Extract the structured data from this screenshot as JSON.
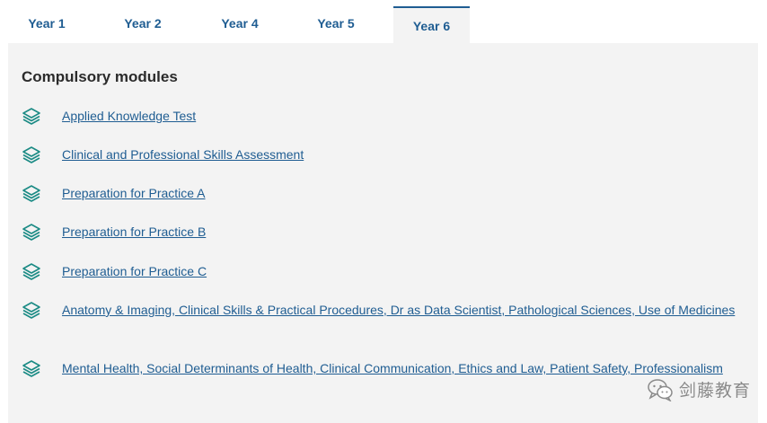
{
  "tabs": [
    {
      "label": "Year 1",
      "active": false
    },
    {
      "label": "Year 2",
      "active": false
    },
    {
      "label": "Year 4",
      "active": false
    },
    {
      "label": "Year 5",
      "active": false
    },
    {
      "label": "Year 6",
      "active": true
    }
  ],
  "section": {
    "title": "Compulsory modules",
    "icon": "layers-icon",
    "modules": [
      {
        "label": "Applied Knowledge Test"
      },
      {
        "label": "Clinical and Professional Skills Assessment"
      },
      {
        "label": "Preparation for Practice A"
      },
      {
        "label": "Preparation for Practice B"
      },
      {
        "label": "Preparation for Practice C"
      },
      {
        "label": "Anatomy & Imaging, Clinical Skills & Practical Procedures, Dr as Data Scientist, Pathological Sciences, Use of Medicines"
      },
      {
        "label": "Mental Health, Social Determinants of Health, Clinical Communication, Ethics and Law, Patient Safety, Professionalism"
      }
    ]
  },
  "watermark": {
    "text": "剑藤教育",
    "icon": "wechat-icon"
  },
  "colors": {
    "link": "#1f5d92",
    "icon_teal": "#1a8a84",
    "panel_bg": "#f3f3f3",
    "active_tab_border": "#1f5d92"
  }
}
